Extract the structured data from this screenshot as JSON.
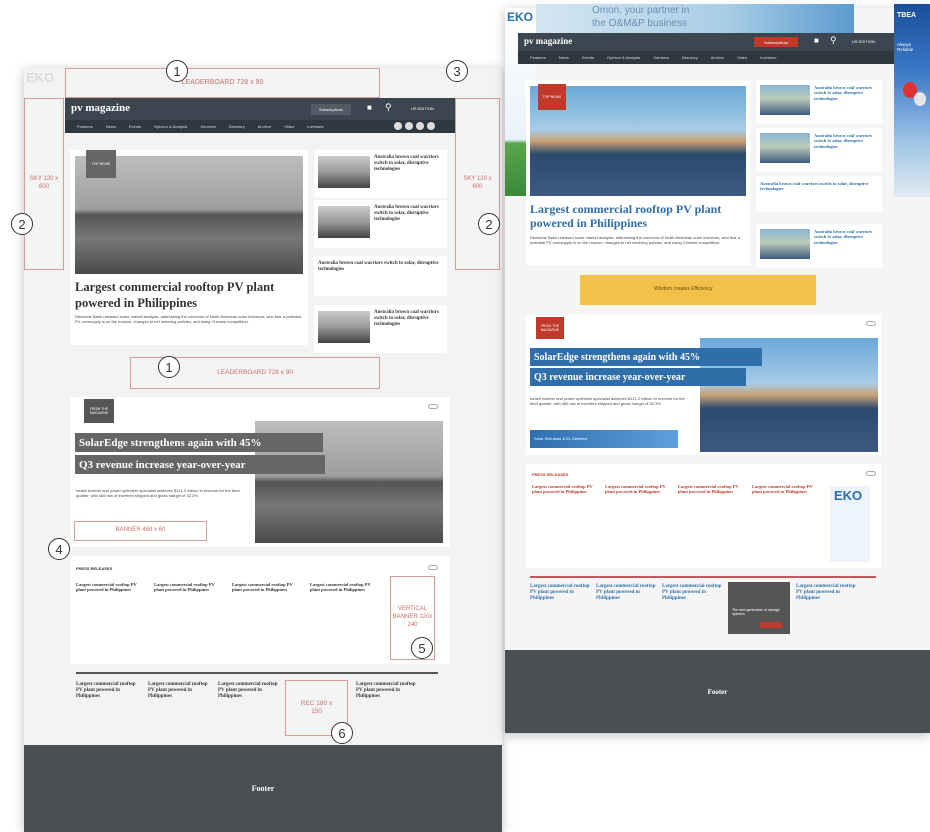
{
  "left": {
    "logo": "pv magazine",
    "subscriptions": "Subscriptions",
    "edition": "US EDITION",
    "nav": [
      "Features",
      "News",
      "Events",
      "Opinion & Analysis",
      "Services",
      "Directory",
      "Archive",
      "Video",
      "Investors"
    ],
    "ad_leaderboard_top": "LEADERBOARD 728 x 90",
    "ad_sky_left": "SKY 120 x 600",
    "ad_sky_right": "SKY 120 x 600",
    "top_news": "TOP NEWS",
    "headline": "Largest commercial rooftop PV plant powered in Philippines",
    "lead": "Deutsche Bank released some market analysis, addressing the concerns of North American solar investors, who fear a potential PV oversupply is on the horizon, changes to net metering policies, and rising Chinese competition.",
    "side_items": [
      "Australia brown coal warriors switch to solar, disruptive technologies",
      "Australia brown coal warriors switch to solar, disruptive technologies",
      "Australia brown coal warriors switch to solar, disruptive technologies",
      "Australia brown coal warriors switch to solar, disruptive technologies"
    ],
    "ad_leaderboard_mid": "LEADERBOARD 728 x 90",
    "from_magazine": "FROM THE MAGAZINE",
    "feature_line1": "SolarEdge strengthens again with 45%",
    "feature_line2": "Q3 revenue increase year-over-year",
    "feature_text": "Israeli inverter and power optimizer specialist achieves $121.2 million in revenue for the third quarter, with 465 mw of inverters shipped and gross margin of 32.3%.",
    "ad_banner": "BANNER 468 x 60",
    "press_releases": "PRESS RELEASES",
    "pr_title": "Largest commercial rooftop PV plant powered in Philippines",
    "ad_vertical": "VERTICAL BANNER 120x 240",
    "bottom_title": "Largest commercial rooftop PV plant powered in Philippines",
    "ad_rec": "REC 180 x 150",
    "footer": "Footer"
  },
  "right": {
    "top_ad_text1": "Omon, your partner in",
    "top_ad_text2": "the O&M&P business",
    "eko": "EKO",
    "tbea": "TBEA",
    "tbea_slogan": "Always Reliable",
    "logo": "pv magazine",
    "subscriptions": "Subscriptions",
    "edition": "US EDITION",
    "nav": [
      "Features",
      "News",
      "Events",
      "Opinion & Analysis",
      "Services",
      "Directory",
      "Archive",
      "Video",
      "Investors"
    ],
    "top_news": "TOP NEWS",
    "headline": "Largest commercial rooftop PV plant powered in Philippines",
    "lead": "Deutsche Bank released some market analysis, addressing the concerns of North American solar investors, who fear a potential PV oversupply is on the horizon, changes to net metering policies, and rising Chinese competition.",
    "side_item": "Australia brown coal warriors switch to solar, disruptive technologies",
    "ad_mid": "Wisdom creates Efficiency",
    "from_magazine": "FROM THE MAGAZINE",
    "feature_line1": "SolarEdge strengthens again with 45%",
    "feature_line2": "Q3 revenue increase year-over-year",
    "feature_text": "Israeli inverter and power optimizer specialist achieves $121.2 million in revenue for the third quarter, with 465 mw of inverters shipped and gross margin of 32.3%.",
    "ad_banner": "Solar Simulator & EL Detector",
    "press_releases": "PRESS RELEASES",
    "pr_title": "Largest commercial rooftop PV plant powered in Philippines",
    "ad_rec": "The next generation of storage systems",
    "footer": "Footer"
  },
  "callouts": [
    "1",
    "2",
    "3",
    "2",
    "2",
    "1",
    "4",
    "5",
    "6"
  ]
}
